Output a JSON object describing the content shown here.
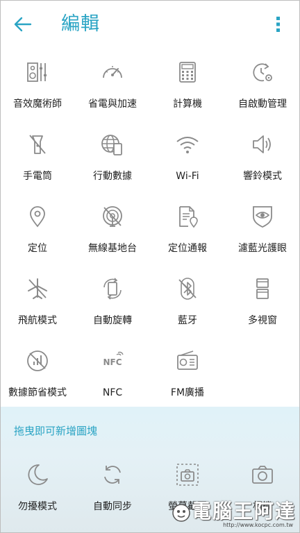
{
  "header": {
    "title": "編輯"
  },
  "tiles": [
    {
      "label": "音效魔術師",
      "icon": "equalizer-speaker-icon"
    },
    {
      "label": "省電與加速",
      "icon": "speedometer-icon"
    },
    {
      "label": "計算機",
      "icon": "calculator-icon"
    },
    {
      "label": "自啟動管理",
      "icon": "auto-start-manager-icon"
    },
    {
      "label": "手電筒",
      "icon": "flashlight-off-icon"
    },
    {
      "label": "行動數據",
      "icon": "mobile-data-icon"
    },
    {
      "label": "Wi-Fi",
      "icon": "wifi-icon"
    },
    {
      "label": "響鈴模式",
      "icon": "speaker-volume-icon"
    },
    {
      "label": "定位",
      "icon": "location-pin-icon"
    },
    {
      "label": "無線基地台",
      "icon": "hotspot-off-icon"
    },
    {
      "label": "定位通報",
      "icon": "location-report-icon"
    },
    {
      "label": "濾藍光護眼",
      "icon": "eye-shield-icon"
    },
    {
      "label": "飛航模式",
      "icon": "airplane-off-icon"
    },
    {
      "label": "自動旋轉",
      "icon": "auto-rotate-icon"
    },
    {
      "label": "藍牙",
      "icon": "bluetooth-off-icon"
    },
    {
      "label": "多視窗",
      "icon": "multi-window-icon"
    },
    {
      "label": "數據節省模式",
      "icon": "data-saver-icon"
    },
    {
      "label": "NFC",
      "icon": "nfc-icon"
    },
    {
      "label": "FM廣播",
      "icon": "fm-radio-icon"
    }
  ],
  "drag_section": {
    "title": "拖曳即可新增圖塊",
    "tiles": [
      {
        "label": "勿擾模式",
        "icon": "moon-icon"
      },
      {
        "label": "自動同步",
        "icon": "sync-icon"
      },
      {
        "label": "螢幕截圖",
        "icon": "screenshot-icon"
      },
      {
        "label": "相機",
        "icon": "camera-icon"
      }
    ]
  },
  "watermark": {
    "text": "電腦王阿達",
    "url": "http://www.kocpc.com.tw"
  },
  "colors": {
    "accent": "#2aa4c4",
    "icon": "#8a8a8a",
    "label": "#222222",
    "section_bg": "#e0f2f8"
  }
}
